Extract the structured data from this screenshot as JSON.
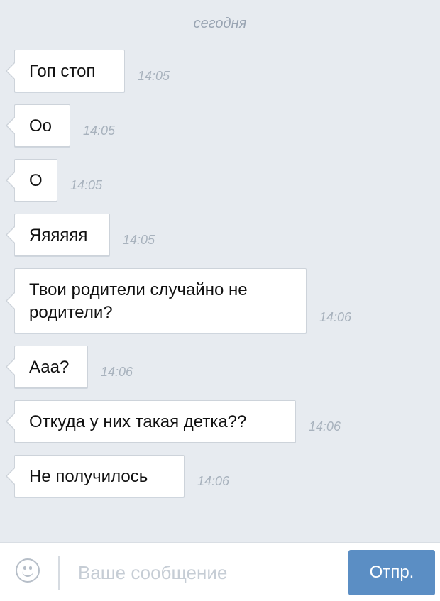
{
  "chat": {
    "date_separator": "сегодня",
    "messages": [
      {
        "text": "Гоп стоп",
        "time": "14:05"
      },
      {
        "text": "Оо",
        "time": "14:05"
      },
      {
        "text": "О",
        "time": "14:05"
      },
      {
        "text": "Яяяяяя",
        "time": "14:05"
      },
      {
        "text": "Твои родители случайно не родители?",
        "time": "14:06"
      },
      {
        "text": "Ааа?",
        "time": "14:06"
      },
      {
        "text": "Откуда у них такая детка??",
        "time": "14:06"
      },
      {
        "text": "Не получилось",
        "time": "14:06"
      }
    ]
  },
  "composer": {
    "emoji_icon": "smiley-icon",
    "placeholder": "Ваше сообщение",
    "send_label": "Отпр."
  },
  "colors": {
    "background": "#e7ebf0",
    "bubble": "#ffffff",
    "timestamp": "#a8b2bd",
    "send_button": "#5b8ec4"
  }
}
